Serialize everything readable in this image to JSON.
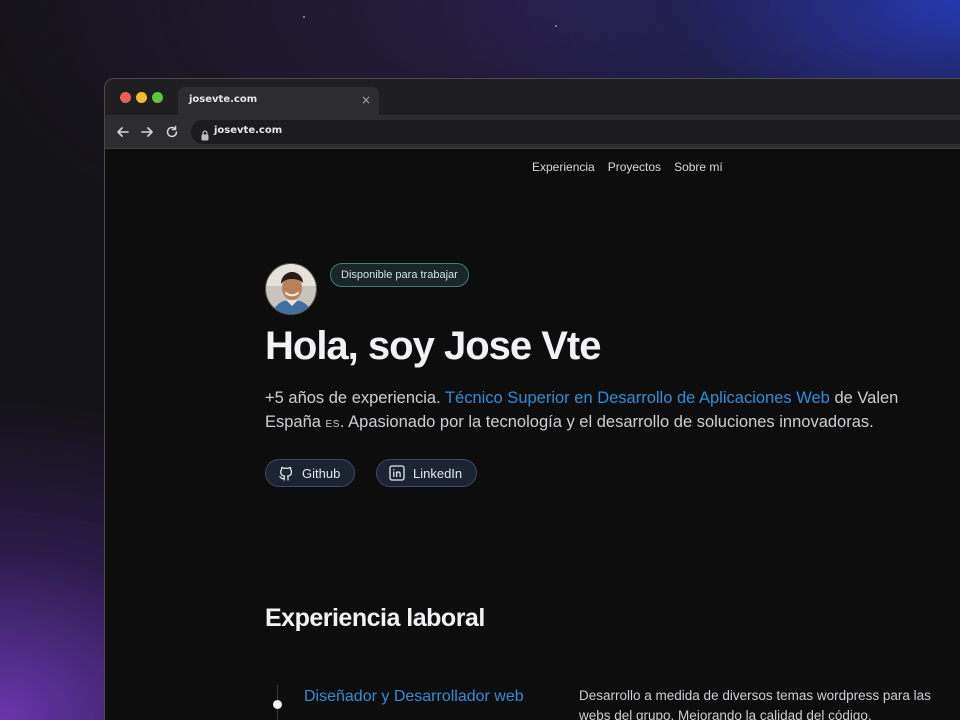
{
  "browser": {
    "tab": {
      "title": "josevte.com",
      "close_glyph": "×"
    },
    "address_bar": {
      "url": "josevte.com"
    },
    "icons": [
      "back-arrow-icon",
      "forward-arrow-icon",
      "reload-icon",
      "lock-icon",
      "close-icon"
    ]
  },
  "nav": {
    "items": [
      {
        "label": "Experiencia"
      },
      {
        "label": "Proyectos"
      },
      {
        "label": "Sobre mí"
      }
    ]
  },
  "hero": {
    "badge": "Disponible para trabajar",
    "title": "Hola, soy Jose Vte",
    "intro": {
      "part1": "+5 años de experiencia. ",
      "highlight": "Técnico Superior en Desarrollo de Aplicaciones Web",
      "part2": " de Valen",
      "part3": "España ",
      "flag": "ES",
      "part4": ". Apasionado por la tecnología y el desarrollo de soluciones innovadoras."
    },
    "links": [
      {
        "label": "Github",
        "icon": "github-icon"
      },
      {
        "label": "LinkedIn",
        "icon": "linkedin-icon"
      }
    ]
  },
  "experience": {
    "heading": "Experiencia laboral",
    "jobs": [
      {
        "title": "Diseñador y Desarrollador web",
        "description": "Desarrollo a medida de diversos temas wordpress para las webs del grupo. Mejorando la calidad del código."
      }
    ]
  },
  "colors": {
    "accent": "#2f8fd6",
    "page_bg": "#0d0d0e",
    "badge_border": "#3f7f7c",
    "social_bg": "#1c2333"
  }
}
